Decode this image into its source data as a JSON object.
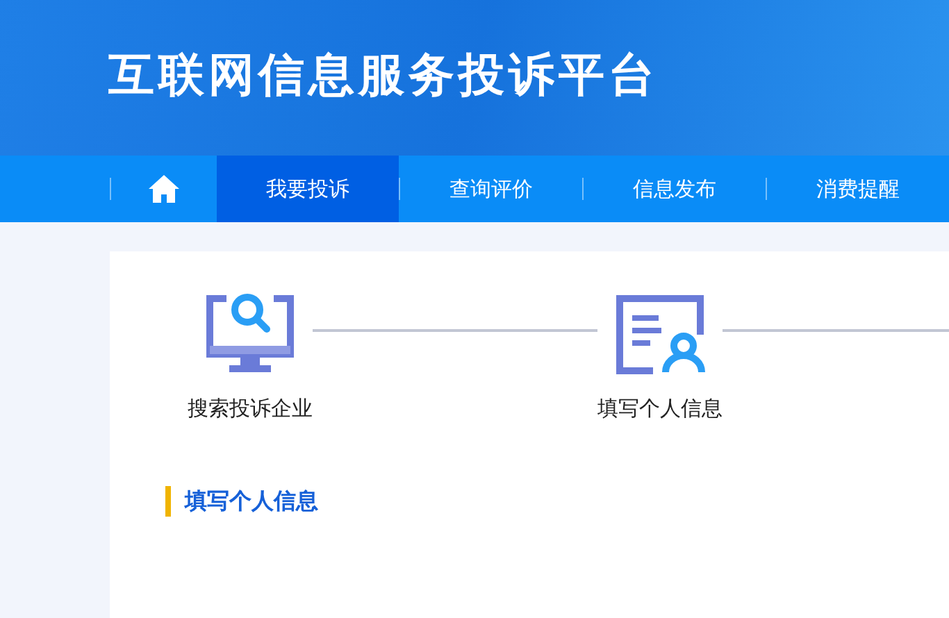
{
  "header": {
    "title": "互联网信息服务投诉平台"
  },
  "nav": [
    {
      "kind": "home",
      "selected": false
    },
    {
      "kind": "text",
      "label": "我要投诉",
      "selected": true
    },
    {
      "kind": "text",
      "label": "查询评价",
      "selected": false
    },
    {
      "kind": "text",
      "label": "信息发布",
      "selected": false
    },
    {
      "kind": "text",
      "label": "消费提醒",
      "selected": false
    }
  ],
  "steps": [
    {
      "kind": "search",
      "label": "搜索投诉企业"
    },
    {
      "kind": "form",
      "label": "填写个人信息"
    }
  ],
  "section": {
    "heading": "填写个人信息"
  }
}
